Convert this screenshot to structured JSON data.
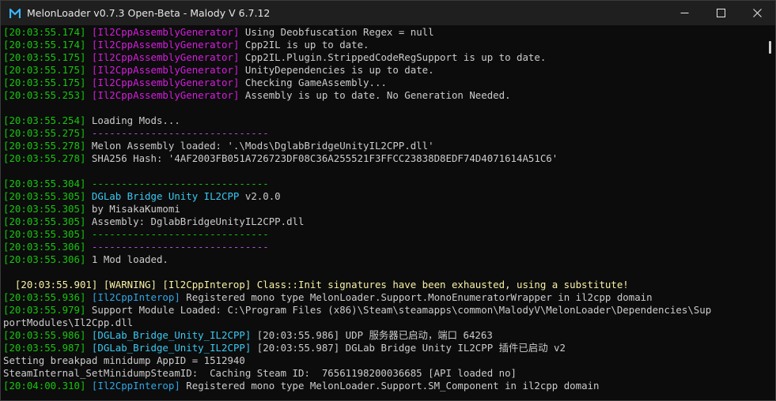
{
  "window": {
    "title": "MelonLoader v0.7.3 Open-Beta - Malody V 6.7.12",
    "minimize_icon": "minimize-icon",
    "maximize_icon": "maximize-icon",
    "close_icon": "close-icon",
    "logo_icon": "melonloader-logo-icon"
  },
  "colors": {
    "timestamp": "#16c60c",
    "il2cpp_assembly_generator": "#d61ddf",
    "il2cpp_interop": "#2ea8e6",
    "dglab": "#3ac9f2",
    "warning": "#f9f1a5",
    "text": "#cccccc",
    "background": "#0c0c0c"
  },
  "log": [
    {
      "ts": "[20:03:55.174]",
      "tag": "[Il2CppAssemblyGenerator]",
      "msg": " Using Deobfuscation Regex = null"
    },
    {
      "ts": "[20:03:55.174]",
      "tag": "[Il2CppAssemblyGenerator]",
      "msg": " Cpp2IL is up to date."
    },
    {
      "ts": "[20:03:55.175]",
      "tag": "[Il2CppAssemblyGenerator]",
      "msg": " Cpp2IL.Plugin.StrippedCodeRegSupport is up to date."
    },
    {
      "ts": "[20:03:55.175]",
      "tag": "[Il2CppAssemblyGenerator]",
      "msg": " UnityDependencies is up to date."
    },
    {
      "ts": "[20:03:55.175]",
      "tag": "[Il2CppAssemblyGenerator]",
      "msg": " Checking GameAssembly..."
    },
    {
      "ts": "[20:03:55.253]",
      "tag": "[Il2CppAssemblyGenerator]",
      "msg": " Assembly is up to date. No Generation Needed."
    },
    {
      "ts": "[20:03:55.254]",
      "msg": " Loading Mods..."
    },
    {
      "ts": "[20:03:55.275]",
      "sep": " ------------------------------"
    },
    {
      "ts": "[20:03:55.278]",
      "msg": " Melon Assembly loaded: '.\\Mods\\DglabBridgeUnityIL2CPP.dll'"
    },
    {
      "ts": "[20:03:55.278]",
      "msg": " SHA256 Hash: '4AF2003FB051A726723DF08C36A255521F3FFCC23838D8EDF74D4071614A51C6'"
    },
    {
      "ts": "[20:03:55.304]",
      "sep": " ------------------------------"
    },
    {
      "ts": "[20:03:55.305]",
      "name": " DGLab Bridge Unity IL2CPP",
      "ver": " v2.0.0"
    },
    {
      "ts": "[20:03:55.305]",
      "msg": " by MisakaKumomi"
    },
    {
      "ts": "[20:03:55.305]",
      "msg": " Assembly: DglabBridgeUnityIL2CPP.dll"
    },
    {
      "ts": "[20:03:55.305]",
      "sep": " ------------------------------"
    },
    {
      "ts": "[20:03:55.306]",
      "sep": " ------------------------------"
    },
    {
      "ts": "[20:03:55.306]",
      "msg": " 1 Mod loaded."
    },
    {
      "warning": "  [20:03:55.901] [WARNING] [Il2CppInterop] Class::Init signatures have been exhausted, using a substitute!"
    },
    {
      "ts": "[20:03:55.936]",
      "tag": "[Il2CppInterop]",
      "msg": " Registered mono type MelonLoader.Support.MonoEnumeratorWrapper in il2cpp domain"
    },
    {
      "ts": "[20:03:55.979]",
      "msg": " Support Module Loaded: C:\\Program Files (x86)\\Steam\\steamapps\\common\\MalodyV\\MelonLoader\\Dependencies\\Sup"
    },
    {
      "plain": "portModules\\Il2Cpp.dll"
    },
    {
      "ts": "[20:03:55.986]",
      "tag": "[DGLab_Bridge_Unity_IL2CPP]",
      "msg": " [20:03:55.986] UDP 服务器已启动，端口 64263"
    },
    {
      "ts": "[20:03:55.987]",
      "tag": "[DGLab_Bridge_Unity_IL2CPP]",
      "msg": " [20:03:55.987] DGLab Bridge Unity IL2CPP 插件已启动 v2"
    },
    {
      "plain": "Setting breakpad minidump AppID = 1512940"
    },
    {
      "plain": "SteamInternal_SetMinidumpSteamID:  Caching Steam ID:  76561198200036685 [API loaded no]"
    },
    {
      "ts": "[20:04:00.310]",
      "tag": "[Il2CppInterop]",
      "msg": " Registered mono type MelonLoader.Support.SM_Component in il2cpp domain"
    }
  ]
}
